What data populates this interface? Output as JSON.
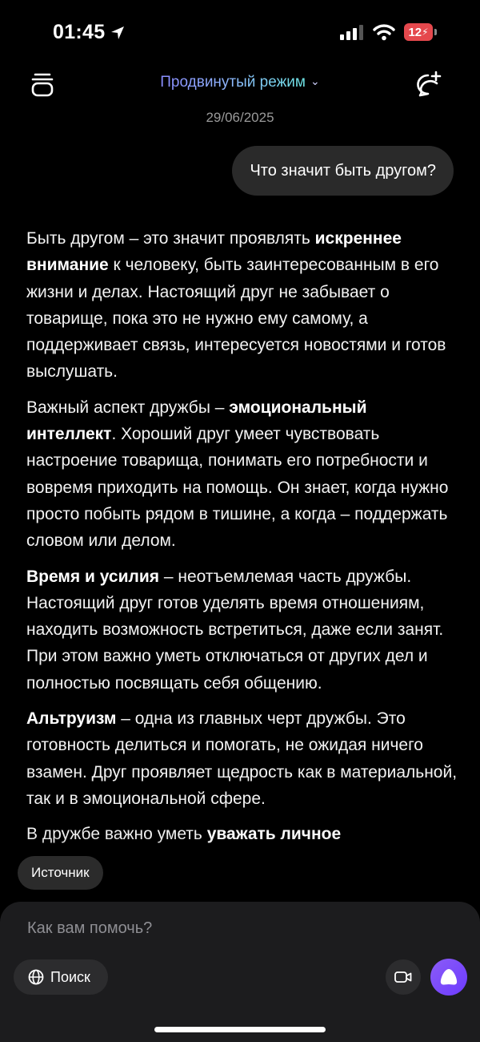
{
  "status_bar": {
    "time": "01:45",
    "battery": "12"
  },
  "header": {
    "mode_title": "Продвинутый режим",
    "date": "29/06/2025"
  },
  "user_message": "Что значит быть другом?",
  "answer": {
    "p1": {
      "a": "Быть другом – это значит проявлять ",
      "b": "искреннее внимание",
      "c": " к человеку, быть заинтересованным в его жизни и делах. Настоящий друг не забывает о товарище, пока это не нужно ему самому, а поддерживает связь, интересуется новостями и готов выслушать."
    },
    "p2": {
      "a": "Важный аспект дружбы – ",
      "b": "эмоциональный интеллект",
      "c": ". Хороший друг умеет чувствовать настроение товарища, понимать его потребности и вовремя приходить на помощь. Он знает, когда нужно просто побыть рядом в тишине, а когда – поддержать словом или делом."
    },
    "p3": {
      "b": "Время и усилия",
      "c": " – неотъемлемая часть дружбы. Настоящий друг готов уделять время отношениям, находить возможность встретиться, даже если занят. При этом важно уметь отключаться от других дел и полностью посвящать себя общению."
    },
    "p4": {
      "b": "Альтруизм",
      "c": " – одна из главных черт дружбы. Это готовность делиться и помогать, не ожидая ничего взамен. Друг проявляет щедрость как в материальной, так и в эмоциональной сфере."
    },
    "p5": {
      "a": "В дружбе важно уметь ",
      "b": "уважать личное"
    }
  },
  "source_chip": "Источник",
  "input": {
    "placeholder": "Как вам помочь?",
    "search_label": "Поиск"
  },
  "colors": {
    "accent_purple": "#7c4dff",
    "battery_red": "#e5484d"
  },
  "icons": [
    "location-arrow-icon",
    "cellular-signal-icon",
    "wifi-icon",
    "battery-icon",
    "history-stack-icon",
    "chevron-down-icon",
    "new-chat-icon",
    "globe-icon",
    "video-icon",
    "alice-icon"
  ]
}
